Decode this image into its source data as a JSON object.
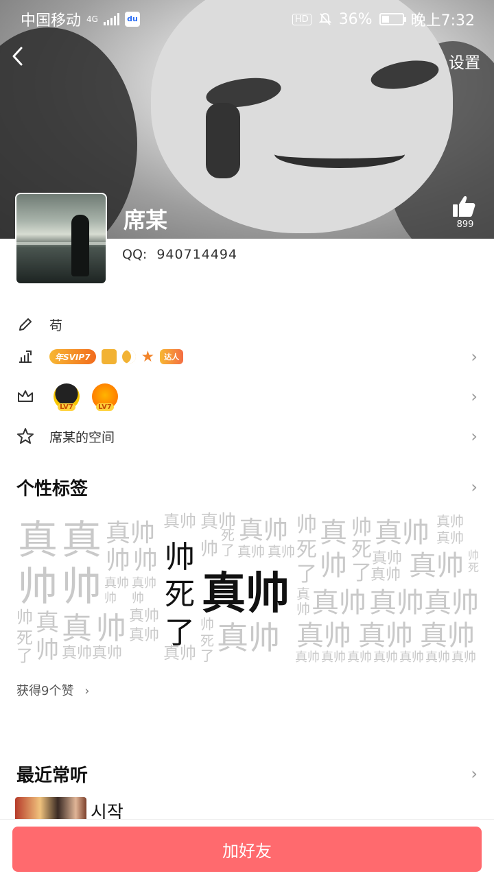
{
  "status_bar": {
    "carrier": "中国移动",
    "network": "4G",
    "hd": "HD",
    "battery": "36%",
    "time": "晚上7:32"
  },
  "header": {
    "back_icon": "chevron-left-icon",
    "settings_label": "设置",
    "like_count": "899"
  },
  "profile": {
    "name": "席某",
    "qq_label": "QQ:",
    "qq_number": "940714494"
  },
  "rows": {
    "signature": "苟",
    "vip_badge": "年SVIP7",
    "daren_badge": "达人",
    "lv1": "LV7",
    "lv2": "LV7",
    "space": "席某的空间"
  },
  "tags": {
    "title": "个性标签",
    "words": [
      "真",
      "帅",
      "死",
      "了",
      "真帅"
    ],
    "likes": "获得9个赞"
  },
  "recent": {
    "title": "最近常听",
    "song": "시작"
  },
  "action": {
    "add_friend": "加好友"
  },
  "colors": {
    "accent": "#ff6a6e"
  }
}
